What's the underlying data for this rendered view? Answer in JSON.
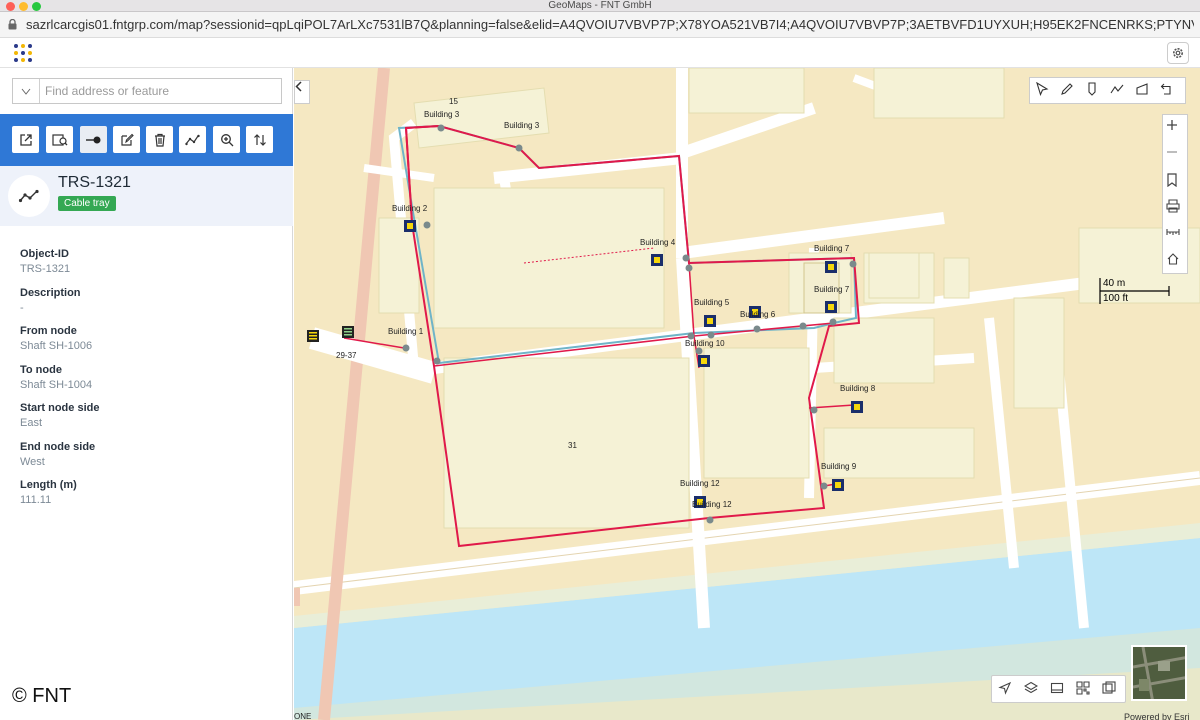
{
  "window": {
    "title": "GeoMaps - FNT GmbH"
  },
  "browser": {
    "url": "sazrlcarcgis01.fntgrp.com/map?sessionid=qpLqiPOL7ArLXc7531lB7Q&planning=false&elid=A4QVOIU7VBVP7P;X78YOA521VB7I4;A4QVOIU7VBVP7P;3AETBVFD1UYXUH;H95EK2FNCENRKS;PTYNVFKIYA1JGN..."
  },
  "search": {
    "placeholder": "Find address or feature"
  },
  "toolbar": {
    "buttons": [
      "open-external",
      "details",
      "connect",
      "edit",
      "delete",
      "route",
      "zoom-to",
      "sort"
    ]
  },
  "object": {
    "title": "TRS-1321",
    "type_badge": "Cable tray",
    "properties": [
      {
        "label": "Object-ID",
        "value": "TRS-1321"
      },
      {
        "label": "Description",
        "value": "-"
      },
      {
        "label": "From node",
        "value": "Shaft SH-1006"
      },
      {
        "label": "To node",
        "value": "Shaft SH-1004"
      },
      {
        "label": "Start node side",
        "value": "East"
      },
      {
        "label": "End node side",
        "value": "West"
      },
      {
        "label": "Length (m)",
        "value": "111.11"
      }
    ]
  },
  "copyright": "© FNT",
  "map": {
    "buildings": [
      "Building 3",
      "Building 3",
      "Building 2",
      "Building 4",
      "Building 7",
      "Building 7",
      "Building 5",
      "Building 6",
      "Building 1",
      "Building 10",
      "Building 8",
      "Building 9",
      "Building 12",
      "Building 12"
    ],
    "parcel_numbers": [
      "15",
      "29-37",
      "31"
    ],
    "scale": {
      "metric": "40 m",
      "imperial": "100 ft"
    },
    "footer_left": "ONE",
    "powered_by": "Powered by Esri"
  },
  "colors": {
    "accent": "#2f78d6",
    "badge": "#34a853",
    "cable": "#e0194a",
    "duct": "#6fb4c8",
    "water": "#bde6f7"
  }
}
